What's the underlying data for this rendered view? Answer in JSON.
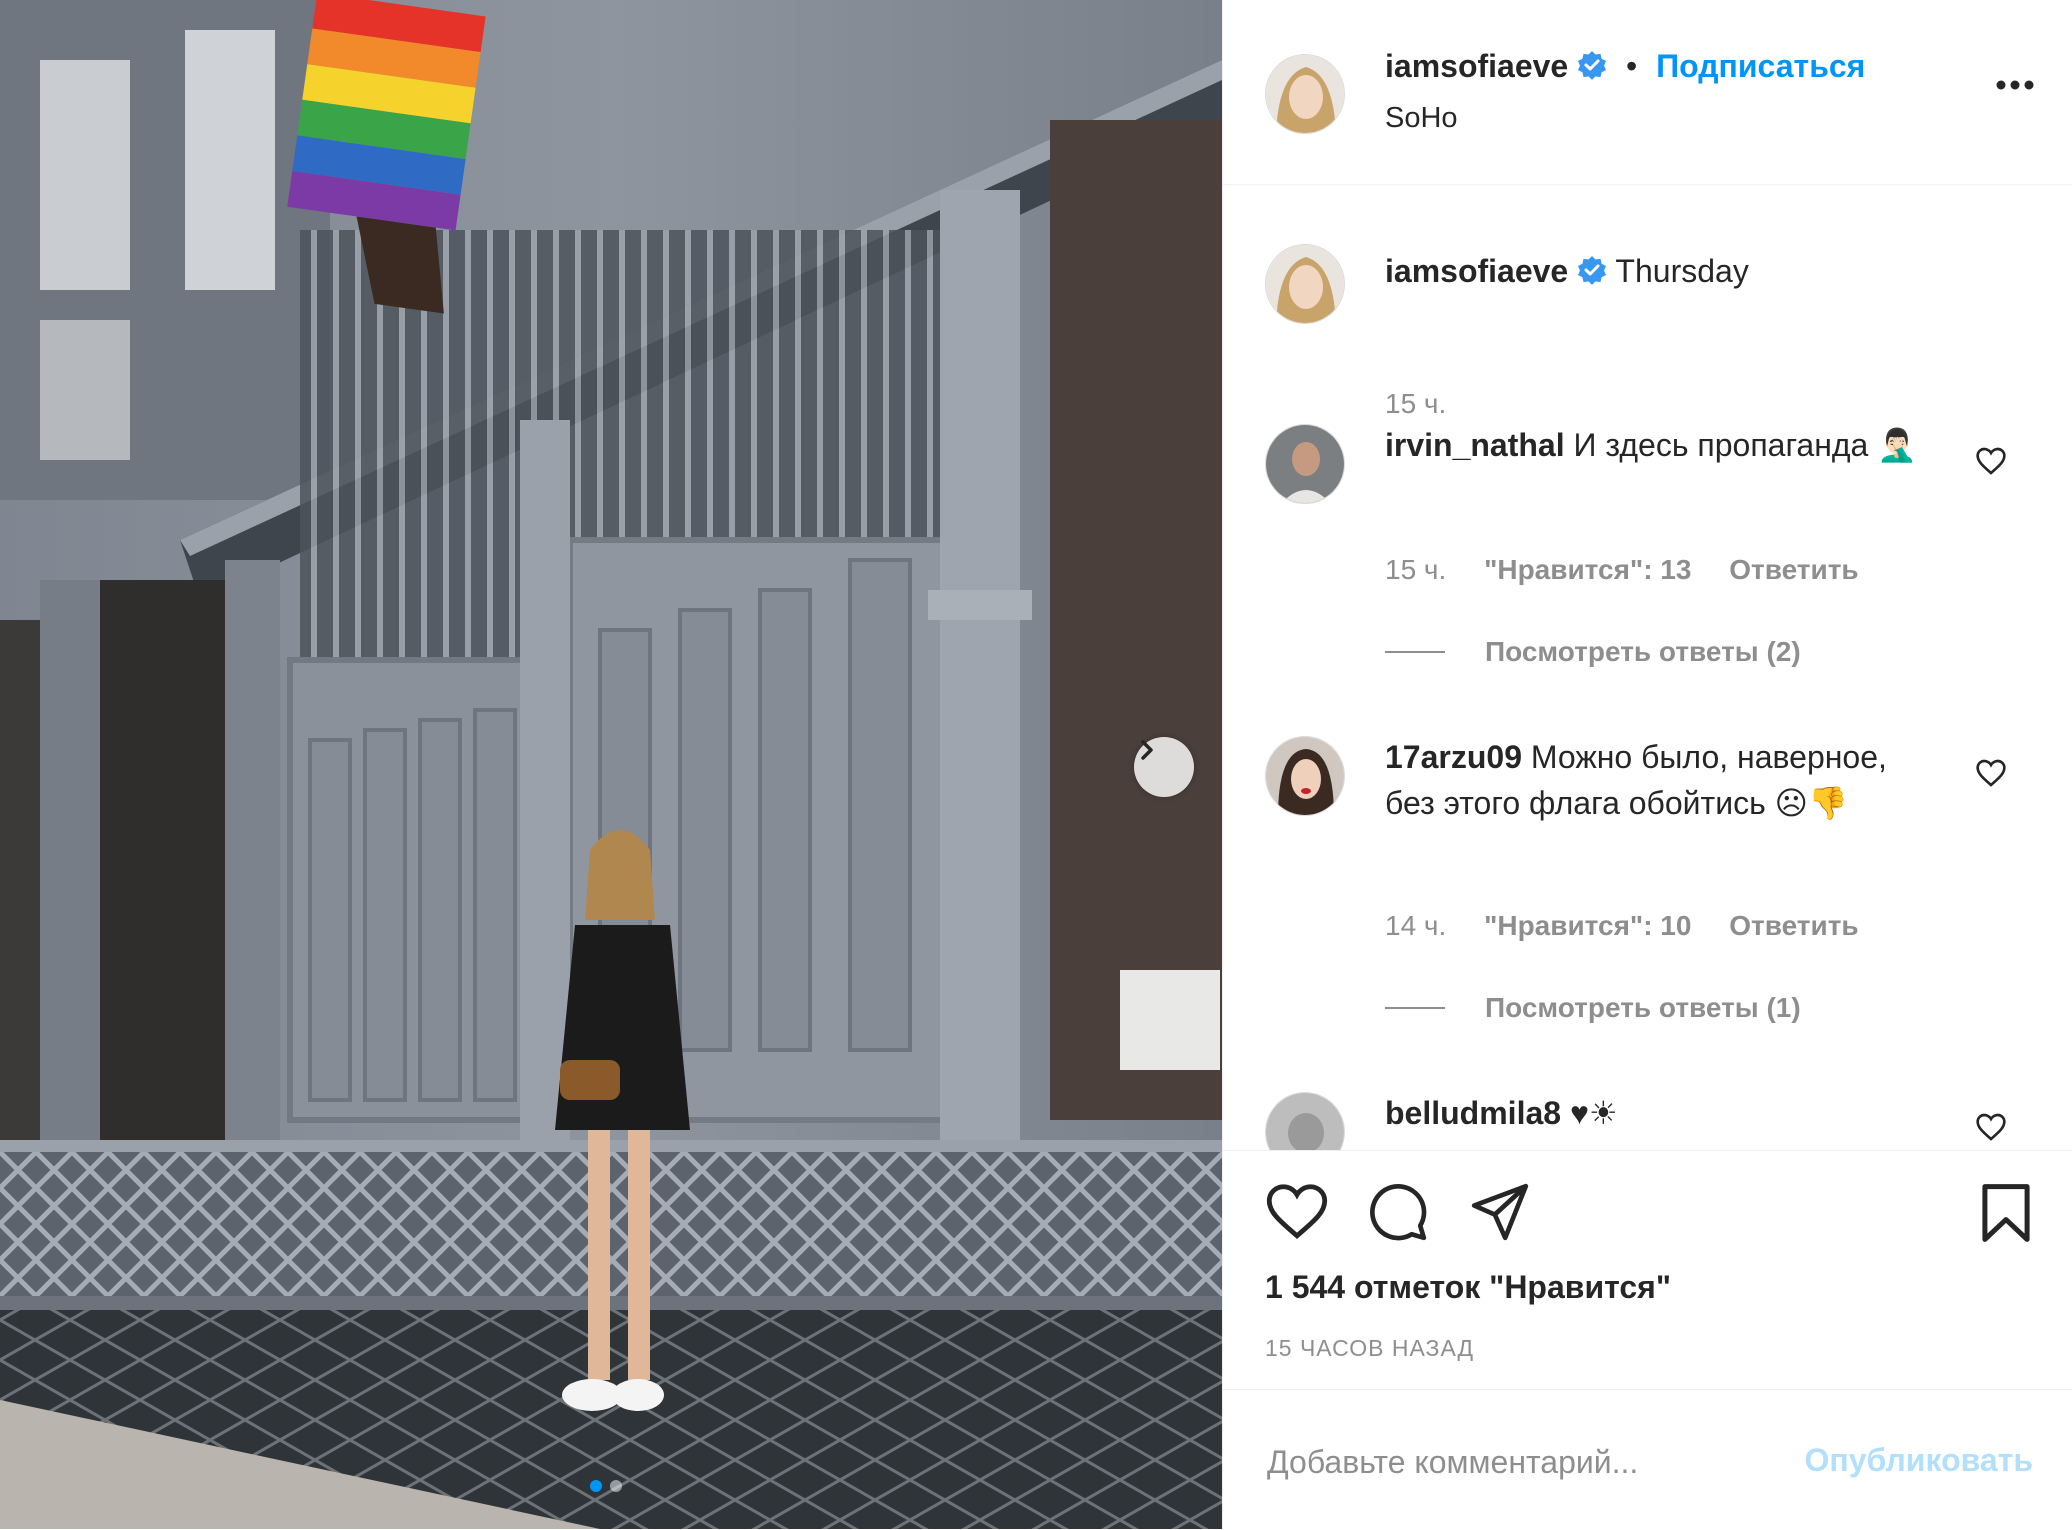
{
  "post": {
    "username": "iamsofiaeve",
    "follow_label": "Подписаться",
    "separator": "•",
    "location": "SoHo",
    "caption": "Thursday",
    "caption_time": "15 ч."
  },
  "comments": [
    {
      "username": "irvin_nathal",
      "text": "И здесь пропаганда 🤦🏻‍♂️",
      "time": "15 ч.",
      "likes": "\"Нравится\": 13",
      "reply_label": "Ответить",
      "view_replies": "Посмотреть ответы (2)"
    },
    {
      "username": "17arzu09",
      "text": "Можно было, наверное, без этого флага обойтись ☹👎",
      "time": "14 ч.",
      "likes": "\"Нравится\": 10",
      "reply_label": "Ответить",
      "view_replies": "Посмотреть ответы (1)"
    },
    {
      "username": "belludmila8",
      "text": "♥☀"
    }
  ],
  "actions": {
    "like_icon": "heart-icon",
    "comment_icon": "comment-icon",
    "share_icon": "paper-plane-icon",
    "save_icon": "bookmark-icon",
    "likes_count": "1 544 отметок \"Нравится\"",
    "time_ago": "15 ЧАСОВ НАЗАД"
  },
  "add_comment": {
    "placeholder": "Добавьте комментарий...",
    "publish_label": "Опубликовать"
  },
  "carousel": {
    "slides": 2,
    "active": 1
  },
  "colors": {
    "accent": "#0095f6",
    "publish_disabled": "#b2dffc",
    "muted": "#8e8e8e",
    "text": "#262626",
    "border": "#efefef"
  }
}
